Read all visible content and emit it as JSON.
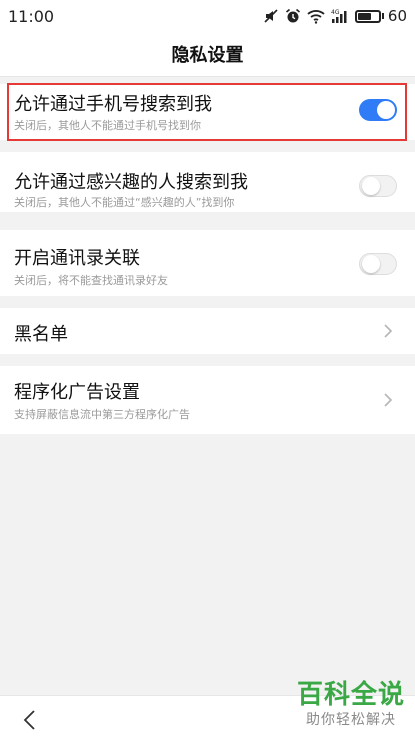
{
  "status_bar": {
    "time": "11:00",
    "battery_text": "60",
    "icons": [
      "mute-icon",
      "alarm-icon",
      "wifi-icon",
      "signal-4g-icon",
      "battery-icon"
    ]
  },
  "header": {
    "title": "隐私设置"
  },
  "settings": [
    {
      "title": "允许通过手机号搜索到我",
      "subtitle": "关闭后，其他人不能通过手机号找到你",
      "control": "toggle",
      "on": true
    },
    {
      "title": "允许通过感兴趣的人搜索到我",
      "subtitle": "关闭后，其他人不能通过“感兴趣的人”找到你",
      "control": "toggle",
      "on": false
    },
    {
      "title": "开启通讯录关联",
      "subtitle": "关闭后，将不能查找通讯录好友",
      "control": "toggle",
      "on": false
    },
    {
      "title": "黑名单",
      "subtitle": "",
      "control": "chevron"
    },
    {
      "title": "程序化广告设置",
      "subtitle": "支持屏蔽信息流中第三方程序化广告",
      "control": "chevron"
    }
  ],
  "colors": {
    "accent": "#2f7cf6",
    "highlight": "#e53935",
    "watermark": "#3aa845"
  },
  "watermark": {
    "logo": "百科全说",
    "slogan": "助你轻松解决"
  }
}
